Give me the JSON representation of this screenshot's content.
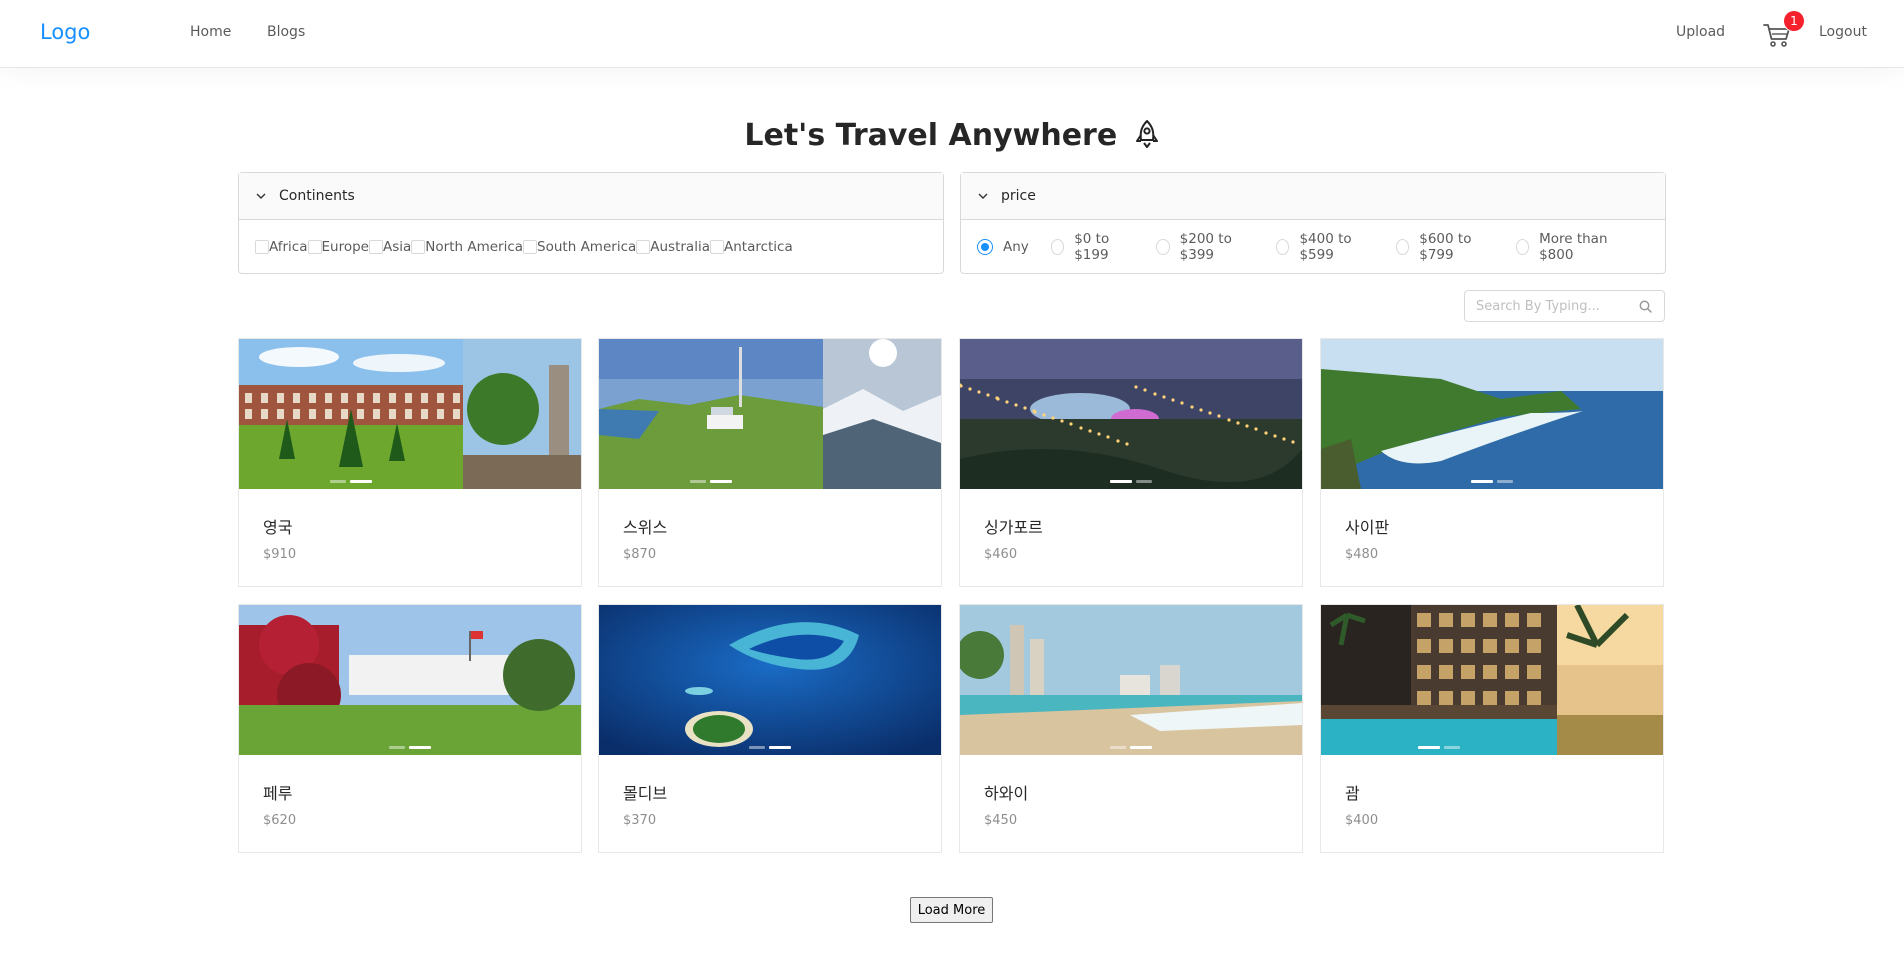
{
  "nav": {
    "logo": "Logo",
    "links": [
      "Home",
      "Blogs"
    ],
    "upload": "Upload",
    "cart_count": "1",
    "logout": "Logout"
  },
  "title": "Let's Travel Anywhere",
  "continents": {
    "header": "Continents",
    "options": [
      "Africa",
      "Europe",
      "Asia",
      "North America",
      "South America",
      "Australia",
      "Antarctica"
    ]
  },
  "price": {
    "header": "price",
    "options": [
      "Any",
      "$0 to $199",
      "$200 to $399",
      "$400 to $599",
      "$600 to $799",
      "More than $800"
    ],
    "selected": "Any"
  },
  "search": {
    "placeholder": "Search By Typing..."
  },
  "products": [
    {
      "title": "영국",
      "price": "$910",
      "slides": 2,
      "active": 1
    },
    {
      "title": "스위스",
      "price": "$870",
      "slides": 2,
      "active": 1
    },
    {
      "title": "싱가포르",
      "price": "$460",
      "slides": 2,
      "active": 0
    },
    {
      "title": "사이판",
      "price": "$480",
      "slides": 2,
      "active": 0
    },
    {
      "title": "페루",
      "price": "$620",
      "slides": 2,
      "active": 1
    },
    {
      "title": "몰디브",
      "price": "$370",
      "slides": 2,
      "active": 1
    },
    {
      "title": "하와이",
      "price": "$450",
      "slides": 2,
      "active": 1
    },
    {
      "title": "괌",
      "price": "$400",
      "slides": 2,
      "active": 0
    }
  ],
  "load_more": "Load More"
}
